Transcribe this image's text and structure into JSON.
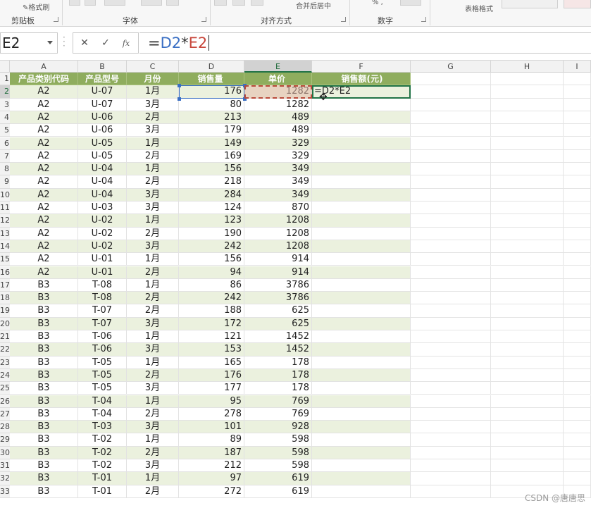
{
  "ribbon": {
    "format_painter": "格式刷",
    "groups": [
      "剪贴板",
      "字体",
      "对齐方式",
      "数字"
    ],
    "merge_center": "合并后居中",
    "table_format": "表格格式"
  },
  "formula_bar": {
    "name_box": "E2",
    "cancel_icon": "✕",
    "confirm_icon": "✓",
    "fx_label": "fx",
    "formula": {
      "eq": "=",
      "ref1": "D2",
      "op": "*",
      "ref2": "E2"
    }
  },
  "columns": [
    "A",
    "B",
    "C",
    "D",
    "E",
    "F",
    "G",
    "H",
    "I"
  ],
  "table_header": [
    "产品类别代码",
    "产品型号",
    "月份",
    "销售量",
    "单价",
    "销售额(元)"
  ],
  "rows": [
    {
      "n": "2",
      "a": "A2",
      "b": "U-07",
      "c": "1月",
      "d": "176",
      "e": "1282",
      "f": "=D2*E2"
    },
    {
      "n": "3",
      "a": "A2",
      "b": "U-07",
      "c": "3月",
      "d": "80",
      "e": "1282",
      "f": ""
    },
    {
      "n": "4",
      "a": "A2",
      "b": "U-06",
      "c": "2月",
      "d": "213",
      "e": "489",
      "f": ""
    },
    {
      "n": "5",
      "a": "A2",
      "b": "U-06",
      "c": "3月",
      "d": "179",
      "e": "489",
      "f": ""
    },
    {
      "n": "6",
      "a": "A2",
      "b": "U-05",
      "c": "1月",
      "d": "149",
      "e": "329",
      "f": ""
    },
    {
      "n": "7",
      "a": "A2",
      "b": "U-05",
      "c": "2月",
      "d": "169",
      "e": "329",
      "f": ""
    },
    {
      "n": "8",
      "a": "A2",
      "b": "U-04",
      "c": "1月",
      "d": "156",
      "e": "349",
      "f": ""
    },
    {
      "n": "9",
      "a": "A2",
      "b": "U-04",
      "c": "2月",
      "d": "218",
      "e": "349",
      "f": ""
    },
    {
      "n": "10",
      "a": "A2",
      "b": "U-04",
      "c": "3月",
      "d": "284",
      "e": "349",
      "f": ""
    },
    {
      "n": "11",
      "a": "A2",
      "b": "U-03",
      "c": "3月",
      "d": "124",
      "e": "870",
      "f": ""
    },
    {
      "n": "12",
      "a": "A2",
      "b": "U-02",
      "c": "1月",
      "d": "123",
      "e": "1208",
      "f": ""
    },
    {
      "n": "13",
      "a": "A2",
      "b": "U-02",
      "c": "2月",
      "d": "190",
      "e": "1208",
      "f": ""
    },
    {
      "n": "14",
      "a": "A2",
      "b": "U-02",
      "c": "3月",
      "d": "242",
      "e": "1208",
      "f": ""
    },
    {
      "n": "15",
      "a": "A2",
      "b": "U-01",
      "c": "1月",
      "d": "156",
      "e": "914",
      "f": ""
    },
    {
      "n": "16",
      "a": "A2",
      "b": "U-01",
      "c": "2月",
      "d": "94",
      "e": "914",
      "f": ""
    },
    {
      "n": "17",
      "a": "B3",
      "b": "T-08",
      "c": "1月",
      "d": "86",
      "e": "3786",
      "f": ""
    },
    {
      "n": "18",
      "a": "B3",
      "b": "T-08",
      "c": "2月",
      "d": "242",
      "e": "3786",
      "f": ""
    },
    {
      "n": "19",
      "a": "B3",
      "b": "T-07",
      "c": "2月",
      "d": "188",
      "e": "625",
      "f": ""
    },
    {
      "n": "20",
      "a": "B3",
      "b": "T-07",
      "c": "3月",
      "d": "172",
      "e": "625",
      "f": ""
    },
    {
      "n": "21",
      "a": "B3",
      "b": "T-06",
      "c": "1月",
      "d": "121",
      "e": "1452",
      "f": ""
    },
    {
      "n": "22",
      "a": "B3",
      "b": "T-06",
      "c": "3月",
      "d": "153",
      "e": "1452",
      "f": ""
    },
    {
      "n": "23",
      "a": "B3",
      "b": "T-05",
      "c": "1月",
      "d": "165",
      "e": "178",
      "f": ""
    },
    {
      "n": "24",
      "a": "B3",
      "b": "T-05",
      "c": "2月",
      "d": "176",
      "e": "178",
      "f": ""
    },
    {
      "n": "25",
      "a": "B3",
      "b": "T-05",
      "c": "3月",
      "d": "177",
      "e": "178",
      "f": ""
    },
    {
      "n": "26",
      "a": "B3",
      "b": "T-04",
      "c": "1月",
      "d": "95",
      "e": "769",
      "f": ""
    },
    {
      "n": "27",
      "a": "B3",
      "b": "T-04",
      "c": "2月",
      "d": "278",
      "e": "769",
      "f": ""
    },
    {
      "n": "28",
      "a": "B3",
      "b": "T-03",
      "c": "3月",
      "d": "101",
      "e": "928",
      "f": ""
    },
    {
      "n": "29",
      "a": "B3",
      "b": "T-02",
      "c": "1月",
      "d": "89",
      "e": "598",
      "f": ""
    },
    {
      "n": "30",
      "a": "B3",
      "b": "T-02",
      "c": "2月",
      "d": "187",
      "e": "598",
      "f": ""
    },
    {
      "n": "31",
      "a": "B3",
      "b": "T-02",
      "c": "3月",
      "d": "212",
      "e": "598",
      "f": ""
    },
    {
      "n": "32",
      "a": "B3",
      "b": "T-01",
      "c": "1月",
      "d": "97",
      "e": "619",
      "f": ""
    },
    {
      "n": "33",
      "a": "B3",
      "b": "T-01",
      "c": "2月",
      "d": "272",
      "e": "619",
      "f": ""
    }
  ],
  "watermark": "CSDN @唐唐思",
  "colors": {
    "header_green": "#8fad5e",
    "band_green": "#ebf1de",
    "ref_blue": "#3a6fc4",
    "ref_red": "#c8463b",
    "active_green": "#217346"
  }
}
